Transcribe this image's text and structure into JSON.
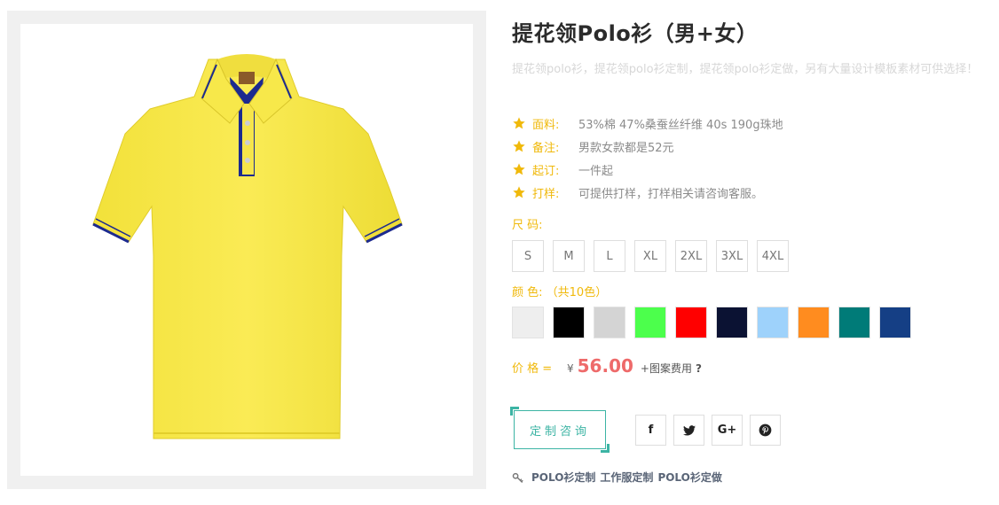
{
  "product": {
    "title": "提花领Polo衫（男+女）",
    "description": "提花领polo衫，提花领polo衫定制，提花领polo衫定做，另有大量设计模板素材可供选择！",
    "image_alt": "yellow polo shirt"
  },
  "specs": [
    {
      "label": "面料:",
      "value": "53%棉 47%桑蚕丝纤维 40s 190g珠地"
    },
    {
      "label": "备注:",
      "value": "男款女款都是52元"
    },
    {
      "label": "起订:",
      "value": "一件起"
    },
    {
      "label": "打样:",
      "value": "可提供打样，打样相关请咨询客服。"
    }
  ],
  "sizes": {
    "label": "尺 码:",
    "options": [
      "S",
      "M",
      "L",
      "XL",
      "2XL",
      "3XL",
      "4XL"
    ]
  },
  "colors": {
    "label": "颜 色:",
    "count_text": "（共10色）",
    "swatches": [
      "#eeeeee",
      "#000000",
      "#d4d4d4",
      "#4cff4c",
      "#ff0000",
      "#0b1233",
      "#9ed2fb",
      "#ff8c1f",
      "#007b78",
      "#153f85"
    ]
  },
  "price": {
    "label": "价 格 =",
    "currency": "¥",
    "amount": "56.00",
    "note": "+图案费用",
    "help": "?"
  },
  "actions": {
    "consult_label": "定制咨询",
    "social": [
      {
        "icon": "facebook-icon",
        "glyph": "f"
      },
      {
        "icon": "twitter-icon",
        "glyph": "🐦"
      },
      {
        "icon": "google-plus-icon",
        "glyph": "G+"
      },
      {
        "icon": "pinterest-icon",
        "glyph": "p"
      }
    ]
  },
  "tags": [
    "POLO衫定制",
    "工作服定制",
    "POLO衫定做"
  ],
  "theme": {
    "accent_yellow": "#f0b90b",
    "teal": "#3cb4a4",
    "price_red": "#ee6a6a",
    "shirt_yellow": "#f7e84a",
    "collar_blue": "#1c2a8f"
  }
}
